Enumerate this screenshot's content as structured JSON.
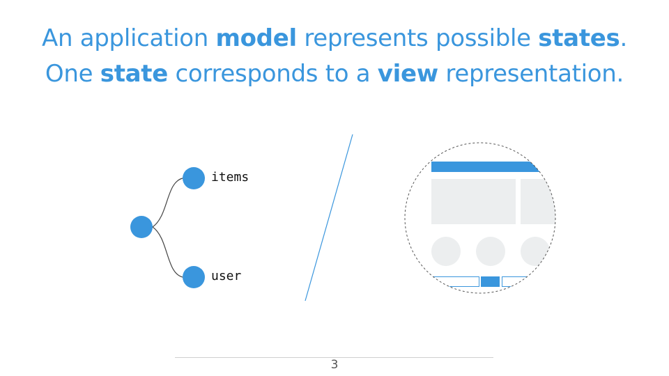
{
  "slide": {
    "title": {
      "line1": {
        "t1": "An application ",
        "b1": "model",
        "t2": " represents possible ",
        "b2": "states",
        "t3": "."
      },
      "line2": {
        "t1": "One ",
        "b1": "state",
        "t2": " corresponds to a ",
        "b2": "view",
        "t3": " representation."
      }
    },
    "tree": {
      "node_labels": [
        "items",
        "user"
      ]
    },
    "page_number": "3"
  },
  "colors": {
    "accent": "#3a96dd",
    "placeholder": "#eceeef",
    "text": "#111111",
    "divider": "#cfcfcf"
  }
}
